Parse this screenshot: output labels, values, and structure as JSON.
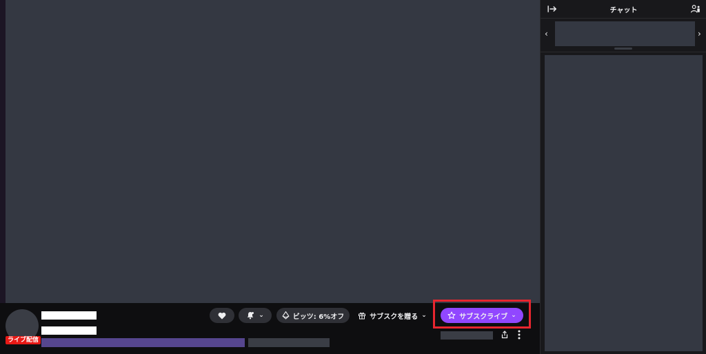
{
  "chat": {
    "title": "チャット"
  },
  "stream": {
    "live_badge": "ライブ配信"
  },
  "actions": {
    "bits_label": "ビッツ: 6%オフ",
    "gift_sub_label": "サブスクを贈る",
    "subscribe_label": "サブスクライブ"
  },
  "icons": {
    "follow": "heart-icon",
    "notify": "bell-icon",
    "bits": "bits-diamond-icon",
    "gift": "gift-icon",
    "subscribe": "star-icon",
    "share": "share-icon",
    "more": "more-vertical-icon",
    "collapse": "collapse-arrow-icon",
    "users": "users-icon"
  },
  "colors": {
    "accent": "#9147ff",
    "live": "#e91916",
    "highlight_box": "#e8262f"
  }
}
